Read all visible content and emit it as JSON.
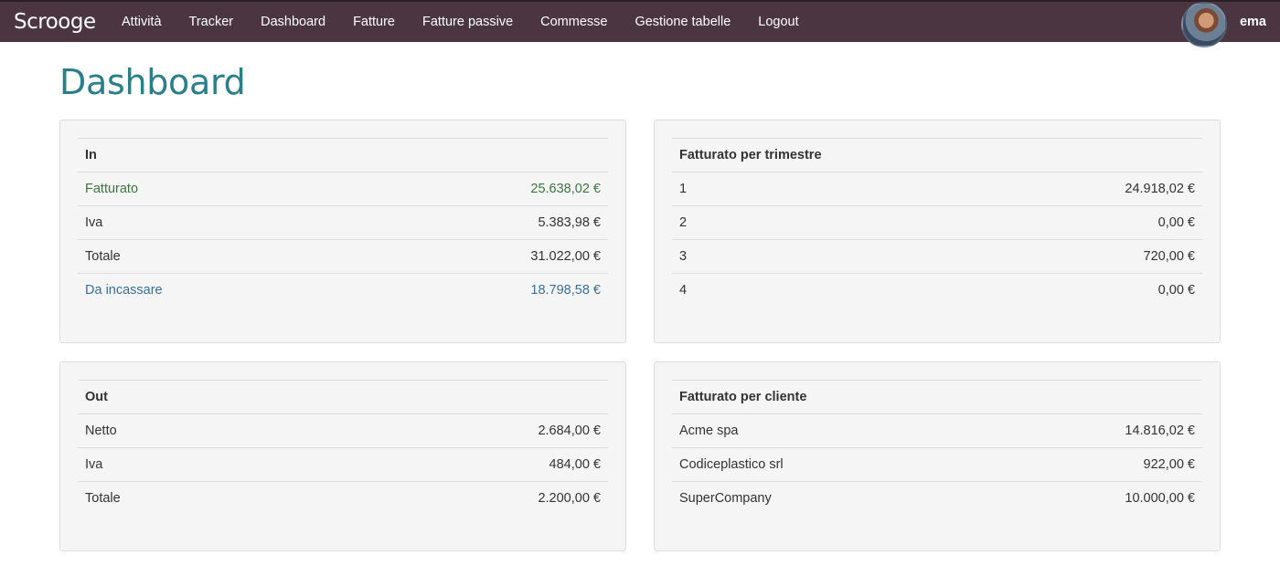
{
  "navbar": {
    "brand": "Scrooge",
    "links": [
      "Attività",
      "Tracker",
      "Dashboard",
      "Fatture",
      "Fatture passive",
      "Commesse",
      "Gestione tabelle",
      "Logout"
    ],
    "username": "ema"
  },
  "page": {
    "title": "Dashboard"
  },
  "panels": {
    "in": {
      "header": "In",
      "rows": [
        {
          "label": "Fatturato",
          "value": "25.638,02 €"
        },
        {
          "label": "Iva",
          "value": "5.383,98 €"
        },
        {
          "label": "Totale",
          "value": "31.022,00 €"
        },
        {
          "label": "Da incassare",
          "value": "18.798,58 €"
        }
      ]
    },
    "trimestre": {
      "header": "Fatturato per trimestre",
      "rows": [
        {
          "label": "1",
          "value": "24.918,02 €"
        },
        {
          "label": "2",
          "value": "0,00 €"
        },
        {
          "label": "3",
          "value": "720,00 €"
        },
        {
          "label": "4",
          "value": "0,00 €"
        }
      ]
    },
    "out": {
      "header": "Out",
      "rows": [
        {
          "label": "Netto",
          "value": "2.684,00 €"
        },
        {
          "label": "Iva",
          "value": "484,00 €"
        },
        {
          "label": "Totale",
          "value": "2.200,00 €"
        }
      ]
    },
    "cliente": {
      "header": "Fatturato per cliente",
      "rows": [
        {
          "label": "Acme spa",
          "value": "14.816,02 €"
        },
        {
          "label": "Codiceplastico srl",
          "value": "922,00 €"
        },
        {
          "label": "SuperCompany",
          "value": "10.000,00 €"
        }
      ]
    }
  },
  "colors": {
    "navbar": "#4a3540",
    "title": "#2a7f8a",
    "positive": "#3c763d",
    "info": "#3a6f9a"
  }
}
